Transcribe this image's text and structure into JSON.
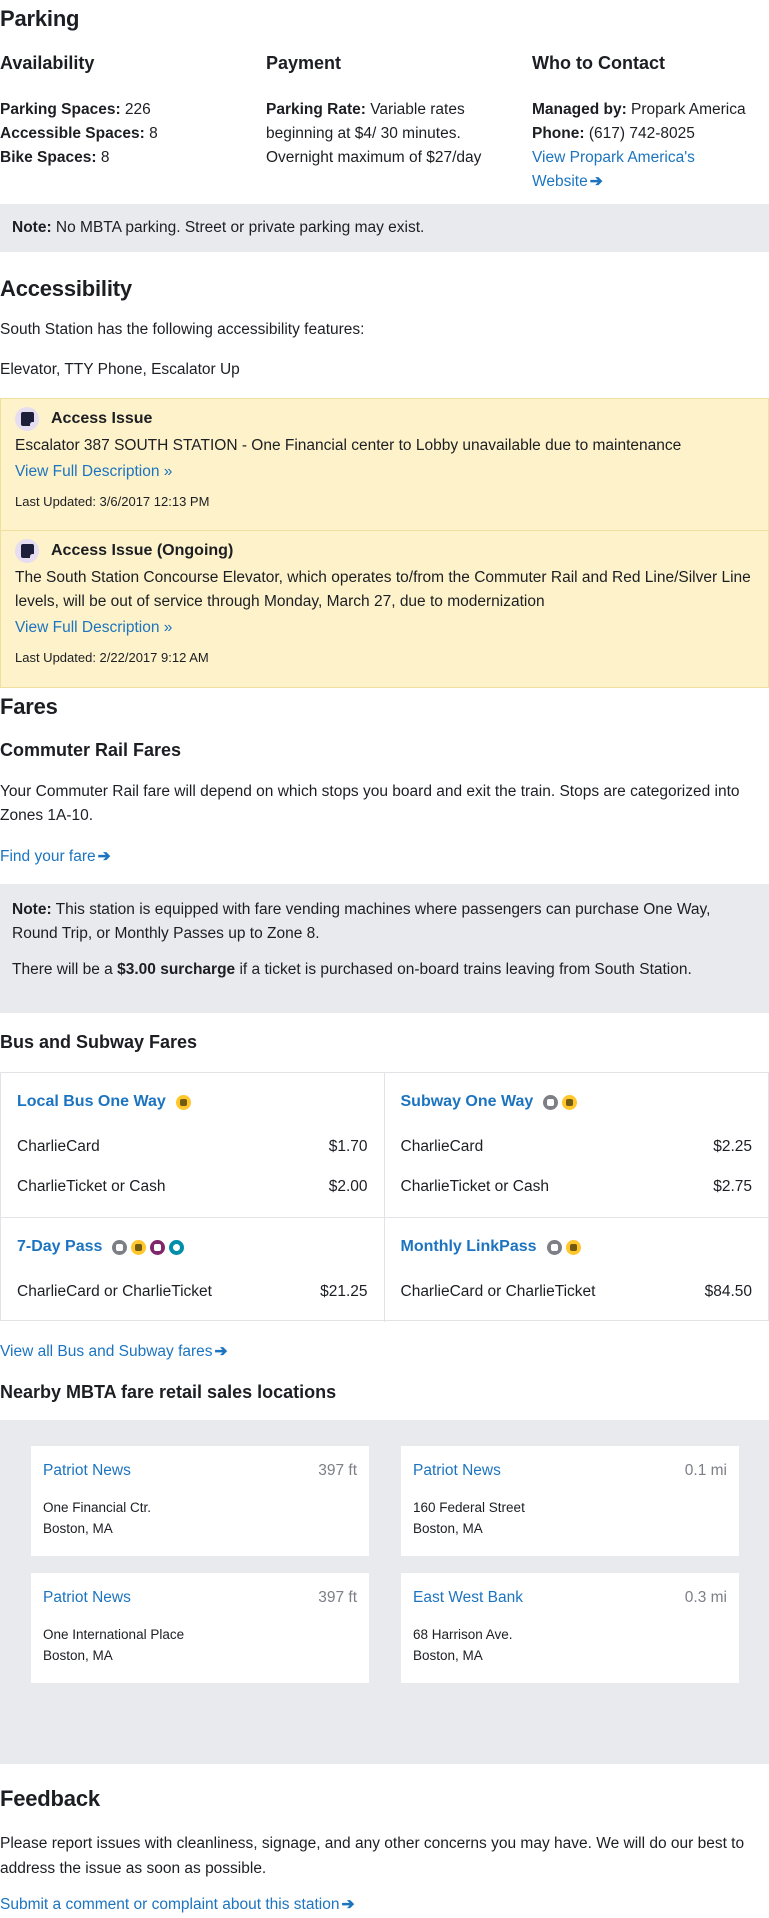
{
  "parking": {
    "title": "Parking",
    "availability": {
      "heading": "Availability",
      "rows": [
        {
          "label": "Parking Spaces:",
          "value": "226"
        },
        {
          "label": "Accessible Spaces:",
          "value": "8"
        },
        {
          "label": "Bike Spaces:",
          "value": "8"
        }
      ]
    },
    "payment": {
      "heading": "Payment",
      "label": "Parking Rate:",
      "value": "Variable rates beginning at $4/ 30 minutes. Overnight maximum of $27/day"
    },
    "contact": {
      "heading": "Who to Contact",
      "managed_label": "Managed by:",
      "managed_value": "Propark America",
      "phone_label": "Phone:",
      "phone_value": "(617) 742-8025",
      "website_link": "View Propark America's Website"
    },
    "note": {
      "label": "Note:",
      "text": "No MBTA parking. Street or private parking may exist."
    }
  },
  "accessibility": {
    "title": "Accessibility",
    "intro": "South Station has the following accessibility features:",
    "features": "Elevator, TTY Phone, Escalator Up",
    "issues": [
      {
        "title": "Access Issue",
        "text": "Escalator 387 SOUTH STATION - One Financial center to Lobby unavailable due to maintenance",
        "link": "View Full Description »",
        "updated": "Last Updated: 3/6/2017 12:13 PM"
      },
      {
        "title": "Access Issue (Ongoing)",
        "text": "The South Station Concourse Elevator, which operates to/from the Commuter Rail and Red Line/Silver Line levels, will be out of service through Monday, March 27, due to modernization",
        "link": "View Full Description »",
        "updated": "Last Updated: 2/22/2017 9:12 AM"
      }
    ]
  },
  "fares": {
    "title": "Fares",
    "commuter_rail": {
      "heading": "Commuter Rail Fares",
      "text": "Your Commuter Rail fare will depend on which stops you board and exit the train. Stops are categorized into Zones 1A-10.",
      "link": "Find your fare"
    },
    "note": {
      "label": "Note:",
      "text": "This station is equipped with fare vending machines where passengers can purchase One Way, Round Trip, or Monthly Passes up to Zone 8.",
      "surcharge_pre": "There will be a",
      "surcharge_bold": "$3.00 surcharge",
      "surcharge_post": "if a ticket is purchased on-board trains leaving from South Station."
    },
    "bus_subway": {
      "heading": "Bus and Subway Fares",
      "cards": [
        {
          "title": "Local Bus One Way",
          "icons": [
            "bus"
          ],
          "rows": [
            {
              "label": "CharlieCard",
              "price": "$1.70"
            },
            {
              "label": "CharlieTicket or Cash",
              "price": "$2.00"
            }
          ]
        },
        {
          "title": "Subway One Way",
          "icons": [
            "subway",
            "bus"
          ],
          "rows": [
            {
              "label": "CharlieCard",
              "price": "$2.25"
            },
            {
              "label": "CharlieTicket or Cash",
              "price": "$2.75"
            }
          ]
        },
        {
          "title": "7-Day Pass",
          "icons": [
            "subway",
            "bus",
            "commuter-rail",
            "ferry"
          ],
          "rows": [
            {
              "label": "CharlieCard or CharlieTicket",
              "price": "$21.25"
            }
          ]
        },
        {
          "title": "Monthly LinkPass",
          "icons": [
            "subway",
            "bus"
          ],
          "rows": [
            {
              "label": "CharlieCard or CharlieTicket",
              "price": "$84.50"
            }
          ]
        }
      ],
      "link": "View all Bus and Subway fares"
    }
  },
  "retail": {
    "heading": "Nearby MBTA fare retail sales locations",
    "locations": [
      {
        "name": "Patriot News",
        "distance": "397 ft",
        "address1": "One Financial Ctr.",
        "address2": "Boston, MA"
      },
      {
        "name": "Patriot News",
        "distance": "0.1 mi",
        "address1": "160 Federal Street",
        "address2": "Boston, MA"
      },
      {
        "name": "Patriot News",
        "distance": "397 ft",
        "address1": "One International Place",
        "address2": "Boston, MA"
      },
      {
        "name": "East West Bank",
        "distance": "0.3 mi",
        "address1": "68 Harrison Ave.",
        "address2": "Boston, MA"
      }
    ]
  },
  "feedback": {
    "title": "Feedback",
    "text": "Please report issues with cleanliness, signage, and any other concerns you may have. We will do our best to address the issue as soon as possible.",
    "link": "Submit a comment or complaint about this station"
  },
  "colors": {
    "link": "#1c74c0",
    "note_bg": "#e9eaed",
    "alert_bg": "#fdf2c9",
    "text": "#1c1e23",
    "muted": "#7c7f86"
  }
}
